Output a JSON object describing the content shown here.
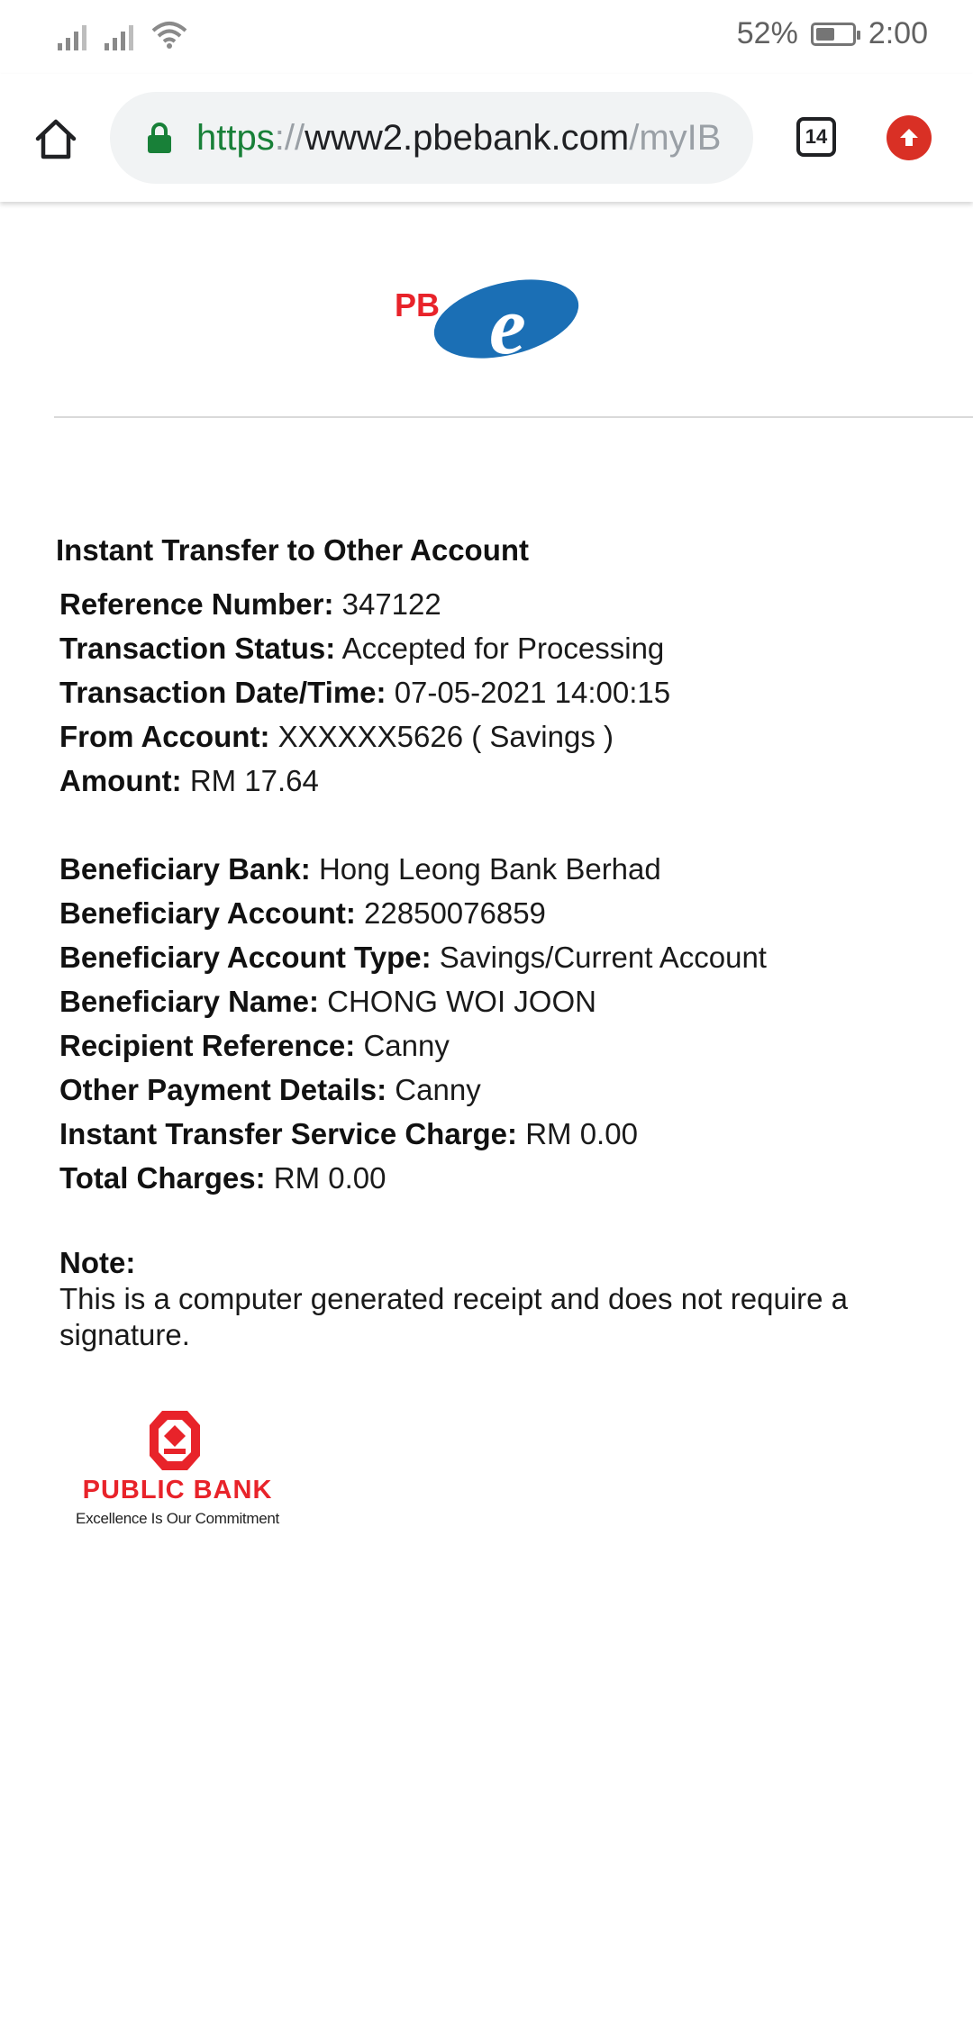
{
  "status_bar": {
    "battery_percent": "52%",
    "battery_level": 0.52,
    "time": "2:00"
  },
  "browser": {
    "url_scheme": "https",
    "url_separator": "://",
    "url_host": "www2.pbebank.com",
    "url_path": "/myIB",
    "tab_count": "14",
    "icons": [
      "home-icon",
      "lock-icon",
      "tab-switcher-icon",
      "update-icon"
    ],
    "colors": {
      "secure": "#188038",
      "update": "#d93025"
    }
  },
  "page": {
    "title": "Instant Transfer to Other Account",
    "details": [
      {
        "label": "Reference Number:",
        "value": "347122"
      },
      {
        "label": "Transaction Status:",
        "value": "Accepted for Processing"
      },
      {
        "label": "Transaction Date/Time:",
        "value": "07-05-2021 14:00:15"
      },
      {
        "label": "From Account:",
        "value": "XXXXXX5626 ( Savings )"
      },
      {
        "label": "Amount:",
        "value": "RM 17.64"
      }
    ],
    "beneficiary": [
      {
        "label": "Beneficiary Bank:",
        "value": "Hong Leong Bank Berhad"
      },
      {
        "label": "Beneficiary Account:",
        "value": "22850076859"
      },
      {
        "label": "Beneficiary Account Type:",
        "value": "Savings/Current Account"
      },
      {
        "label": "Beneficiary Name:",
        "value": "CHONG WOI JOON"
      },
      {
        "label": "Recipient Reference:",
        "value": "Canny"
      },
      {
        "label": "Other Payment Details:",
        "value": "Canny"
      },
      {
        "label": "Instant Transfer Service Charge:",
        "value": "RM 0.00"
      },
      {
        "label": "Total Charges:",
        "value": "RM 0.00"
      }
    ],
    "note_label": "Note:",
    "note_text": "This is a computer generated receipt and does not require a signature.",
    "footer_logo": {
      "name": "PUBLIC BANK",
      "tagline": "Excellence Is Our Commitment"
    },
    "header_logo_text": "PB"
  }
}
